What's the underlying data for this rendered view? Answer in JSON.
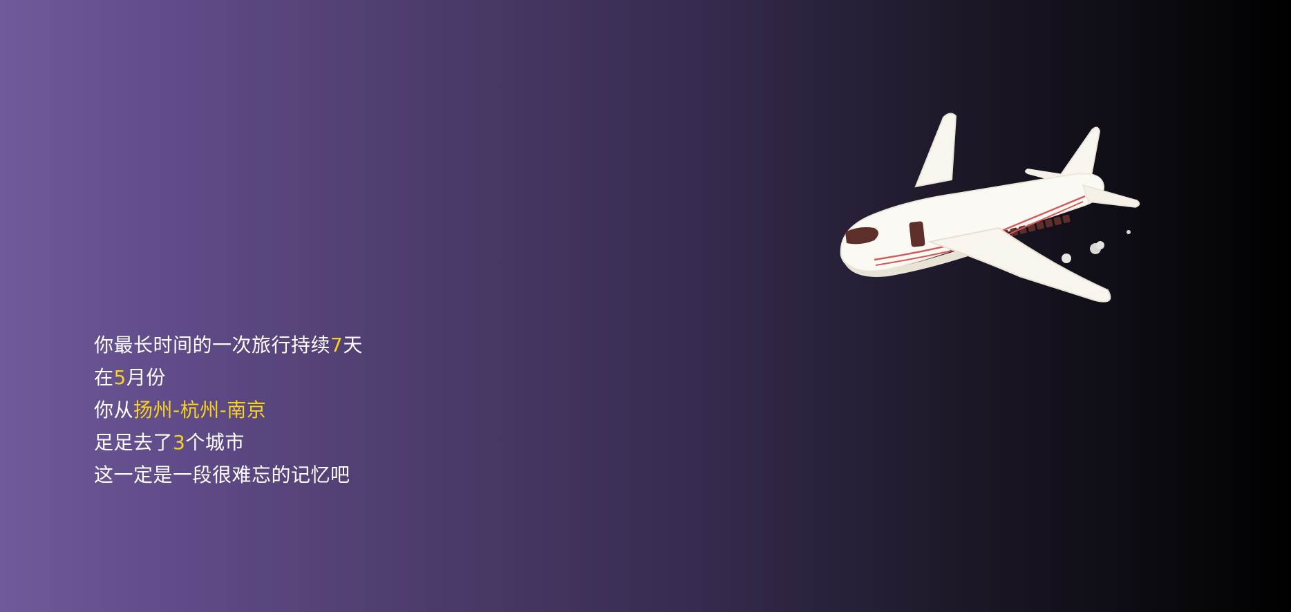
{
  "story": {
    "line1": {
      "pre": "你最长时间的一次旅行持续",
      "days": "7",
      "post": "天"
    },
    "line2": {
      "pre": "在",
      "month": "5",
      "post": "月份"
    },
    "line3": {
      "pre": "你从",
      "route": "扬州-杭州-南京"
    },
    "line4": {
      "pre": "足足去了",
      "cities": "3",
      "post": "个城市"
    },
    "line5": {
      "text": "这一定是一段很难忘的记忆吧"
    }
  },
  "illustration": {
    "icon": "airplane-icon"
  },
  "colors": {
    "highlight": "#f7d21e",
    "text": "#ffffff",
    "bg_start": "#705a9b",
    "bg_end": "#000000"
  }
}
